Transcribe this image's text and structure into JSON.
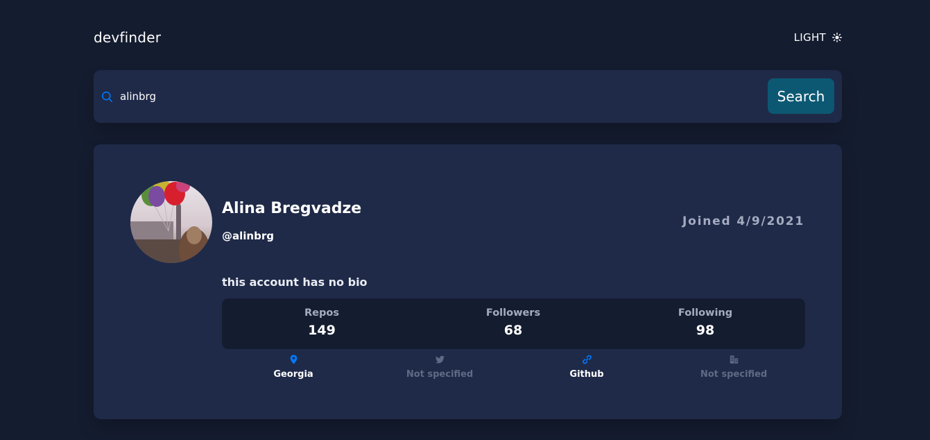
{
  "header": {
    "logo": "devfinder",
    "theme_label": "LIGHT",
    "theme_icon": "sun-icon"
  },
  "search": {
    "icon": "search-icon",
    "value": "alinbrg",
    "button_label": "Search"
  },
  "profile": {
    "name": "Alina Bregvadze",
    "login": "@alinbrg",
    "joined": "Joined 4/9/2021",
    "bio": "this account has no bio",
    "stats": [
      {
        "label": "Repos",
        "value": "149"
      },
      {
        "label": "Followers",
        "value": "68"
      },
      {
        "label": "Following",
        "value": "98"
      }
    ],
    "links": [
      {
        "icon": "location-icon",
        "text": "Georgia",
        "available": true
      },
      {
        "icon": "twitter-icon",
        "text": "Not specified",
        "available": false
      },
      {
        "icon": "link-icon",
        "text": "Github",
        "available": true
      },
      {
        "icon": "company-icon",
        "text": "Not specified",
        "available": false
      }
    ]
  },
  "colors": {
    "background": "#141c2f",
    "card": "#1f2a48",
    "accent_blue": "#0079ff",
    "button": "#0c5873",
    "muted": "#5f6a85"
  }
}
